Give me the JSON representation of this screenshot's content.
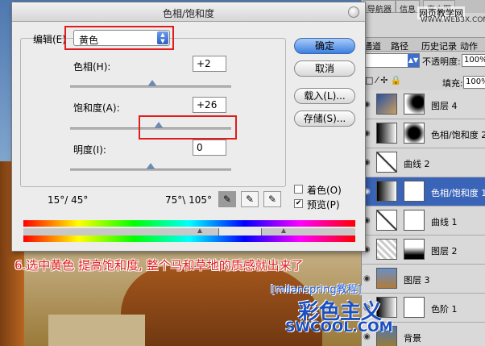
{
  "dialog": {
    "title": "色相/饱和度",
    "edit_label": "编辑(E)",
    "edit_value": "黄色",
    "hue_label": "色相(H):",
    "hue_value": "+2",
    "saturation_label": "饱和度(A):",
    "saturation_value": "+26",
    "lightness_label": "明度(I):",
    "lightness_value": "0",
    "range_left": "15°/ 45°",
    "range_right": "75°\\ 105°",
    "buttons": {
      "ok": "确定",
      "cancel": "取消",
      "load": "载入(L)...",
      "save": "存储(S)..."
    },
    "colorize_label": "着色(O)",
    "colorize_checked": false,
    "preview_label": "预览(P)",
    "preview_checked": true,
    "slider_levels": {
      "hue": 0.51,
      "saturation": 0.55,
      "lightness": 0.5
    }
  },
  "panel": {
    "top_tabs": [
      "导航器",
      "信息",
      "直方图"
    ],
    "tabs": [
      "通道",
      "路径",
      "历史记录",
      "动作"
    ],
    "opacity_label": "不透明度:",
    "opacity_value": "100%",
    "fill_label": "填充:",
    "fill_value": "100%",
    "lock_icons": "□ ⁄ ✢ 🔒",
    "layers": [
      {
        "name": "图层 4",
        "selected": false
      },
      {
        "name": "色相/饱和度 2",
        "selected": false
      },
      {
        "name": "曲线 2",
        "selected": false
      },
      {
        "name": "色相/饱和度 1",
        "selected": true
      },
      {
        "name": "曲线 1",
        "selected": false
      },
      {
        "name": "图层 2",
        "selected": false
      },
      {
        "name": "图层 3",
        "selected": false
      },
      {
        "name": "色阶 1",
        "selected": false
      },
      {
        "name": "背景",
        "selected": false
      }
    ]
  },
  "watermark": {
    "site_top": "网页教学网",
    "site_top_url": "WWW.WEB3X.COM",
    "blog": "[milanspring教程]",
    "brand": "彩色主义",
    "brand_url": "SWCOOL.COM"
  },
  "caption": "6.选中黄色 提高饱和度, 整个马和草地的质感就出来了",
  "colors": {
    "accent": "#e01c1c",
    "selection": "#3a64b8",
    "ok_button": "#3c7fe0"
  }
}
